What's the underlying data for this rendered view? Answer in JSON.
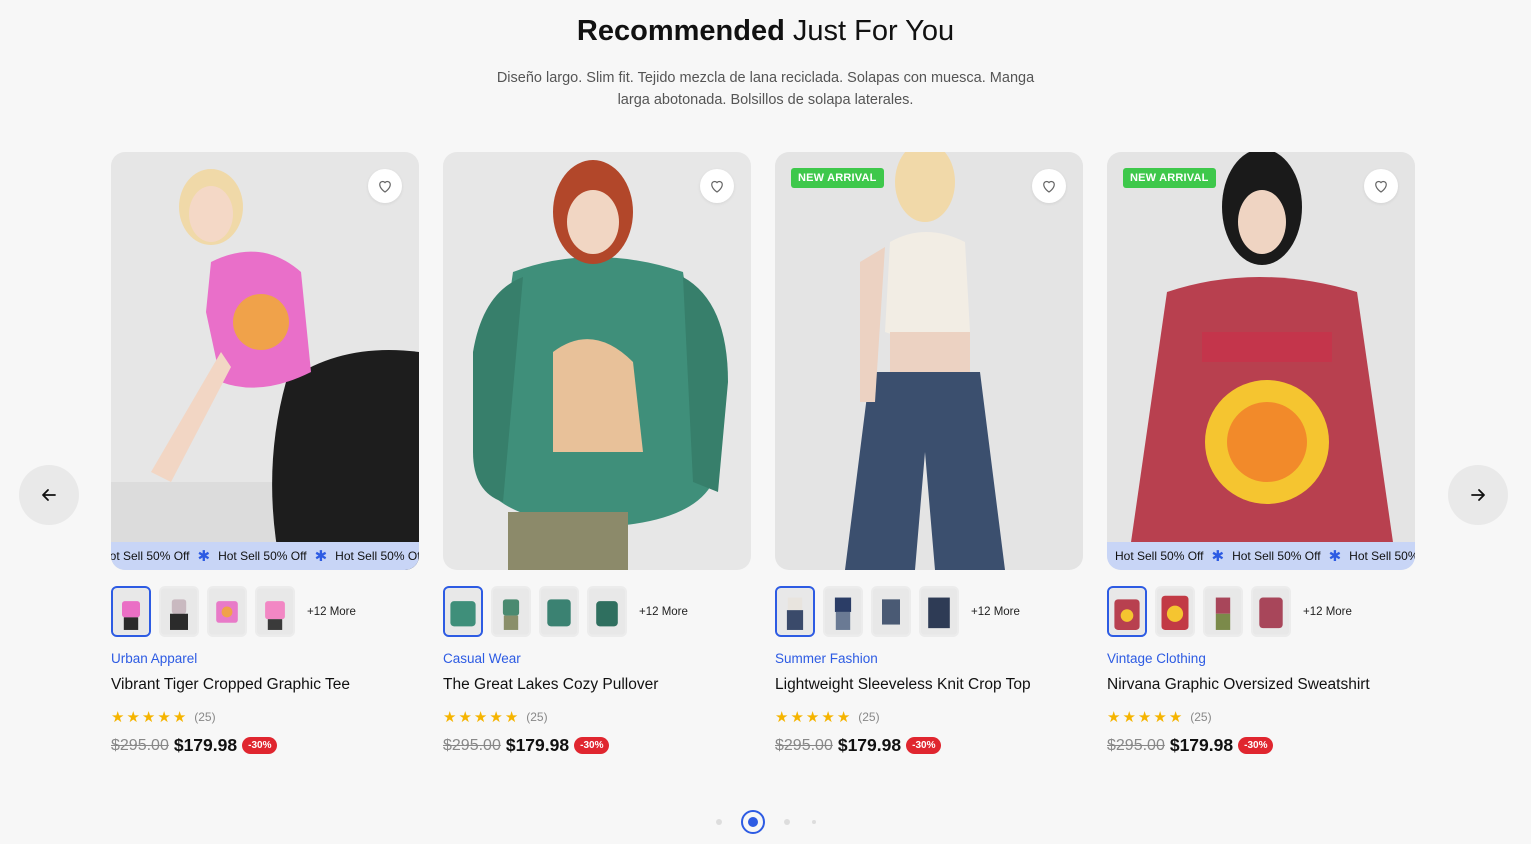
{
  "section": {
    "title_strong": "Recommended",
    "title_light": "Just For You",
    "description": "Diseño largo. Slim fit. Tejido mezcla de lana reciclada. Solapas con muesca. Manga larga abotonada. Bolsillos de solapa laterales."
  },
  "nav": {
    "prev_icon": "arrow-left-icon",
    "next_icon": "arrow-right-icon"
  },
  "marquee": {
    "text": "Hot Sell 50% Off",
    "star": "✱"
  },
  "products": [
    {
      "badge": "",
      "brand": "Urban Apparel",
      "name": "Vibrant Tiger Cropped Graphic Tee",
      "rating": 5,
      "reviews": "(25)",
      "old_price": "$295.00",
      "price": "$179.98",
      "discount": "-30%",
      "more": "+12 More",
      "has_marquee": true,
      "colors": [
        "#ea6fc5",
        "#2b2b2b",
        "#e87ac8",
        "#f287c4"
      ]
    },
    {
      "badge": "",
      "brand": "Casual Wear",
      "name": "The Great Lakes Cozy Pullover",
      "rating": 5,
      "reviews": "(25)",
      "old_price": "$295.00",
      "price": "$179.98",
      "discount": "-30%",
      "more": "+12 More",
      "has_marquee": false,
      "colors": [
        "#3f8f7a",
        "#8a8f6a",
        "#3b8272",
        "#2f6f5f"
      ]
    },
    {
      "badge": "NEW ARRIVAL",
      "brand": "Summer Fashion",
      "name": "Lightweight Sleeveless Knit Crop Top",
      "rating": 5,
      "reviews": "(25)",
      "old_price": "$295.00",
      "price": "$179.98",
      "discount": "-30%",
      "more": "+12 More",
      "has_marquee": false,
      "colors": [
        "#e8e4de",
        "#3a4a6a",
        "#4a5a74",
        "#2e3b55"
      ]
    },
    {
      "badge": "NEW ARRIVAL",
      "brand": "Vintage Clothing",
      "name": "Nirvana Graphic Oversized Sweatshirt",
      "rating": 5,
      "reviews": "(25)",
      "old_price": "$295.00",
      "price": "$179.98",
      "discount": "-30%",
      "more": "+12 More",
      "has_marquee": true,
      "colors": [
        "#b8404f",
        "#c23a45",
        "#7b8a4a",
        "#a8465a"
      ]
    }
  ],
  "pagination": {
    "count": 4,
    "active_index": 1
  }
}
